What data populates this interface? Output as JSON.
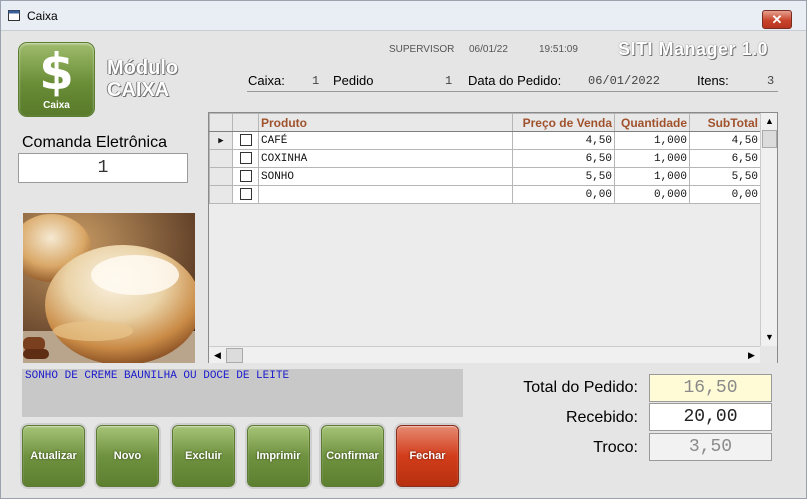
{
  "window": {
    "title": "Caixa",
    "close_glyph": "✕"
  },
  "header": {
    "logo_glyph": "$",
    "logo_caption": "Caixa",
    "module_line1": "Módulo",
    "module_line2": "CAIXA",
    "user": "SUPERVISOR",
    "date": "06/01/22",
    "time": "19:51:09",
    "brand": "SITI Manager 1.0"
  },
  "order_info": {
    "caixa_label": "Caixa:",
    "caixa_value": "1",
    "pedido_label": "Pedido",
    "pedido_value": "1",
    "data_label": "Data do Pedido:",
    "data_value": "06/01/2022",
    "itens_label": "Itens:",
    "itens_value": "3"
  },
  "comanda": {
    "label": "Comanda Eletrônica",
    "value": "1"
  },
  "grid": {
    "columns": [
      "Produto",
      "Preço de Venda",
      "Quantidade",
      "SubTotal"
    ],
    "rows": [
      {
        "produto": "CAFÉ",
        "preco": "4,50",
        "qtd": "1,000",
        "subtotal": "4,50"
      },
      {
        "produto": "COXINHA",
        "preco": "6,50",
        "qtd": "1,000",
        "subtotal": "6,50"
      },
      {
        "produto": "SONHO",
        "preco": "5,50",
        "qtd": "1,000",
        "subtotal": "5,50"
      },
      {
        "produto": "",
        "preco": "0,00",
        "qtd": "0,000",
        "subtotal": "0,00"
      }
    ]
  },
  "description": "SONHO DE CREME BAUNILHA OU DOCE DE LEITE",
  "totals": {
    "total_label": "Total do Pedido:",
    "total_value": "16,50",
    "recebido_label": "Recebido:",
    "recebido_value": "20,00",
    "troco_label": "Troco:",
    "troco_value": "3,50"
  },
  "buttons": {
    "atualizar": "Atualizar",
    "novo": "Novo",
    "excluir": "Excluir",
    "imprimir": "Imprimir",
    "confirmar": "Confirmar",
    "fechar": "Fechar"
  },
  "colors": {
    "accent_green": "#6f9240",
    "close_red": "#d23d1b",
    "header_text": "#a0522d",
    "desc_text": "#1a1acd",
    "total_bg": "#fffbd6"
  }
}
